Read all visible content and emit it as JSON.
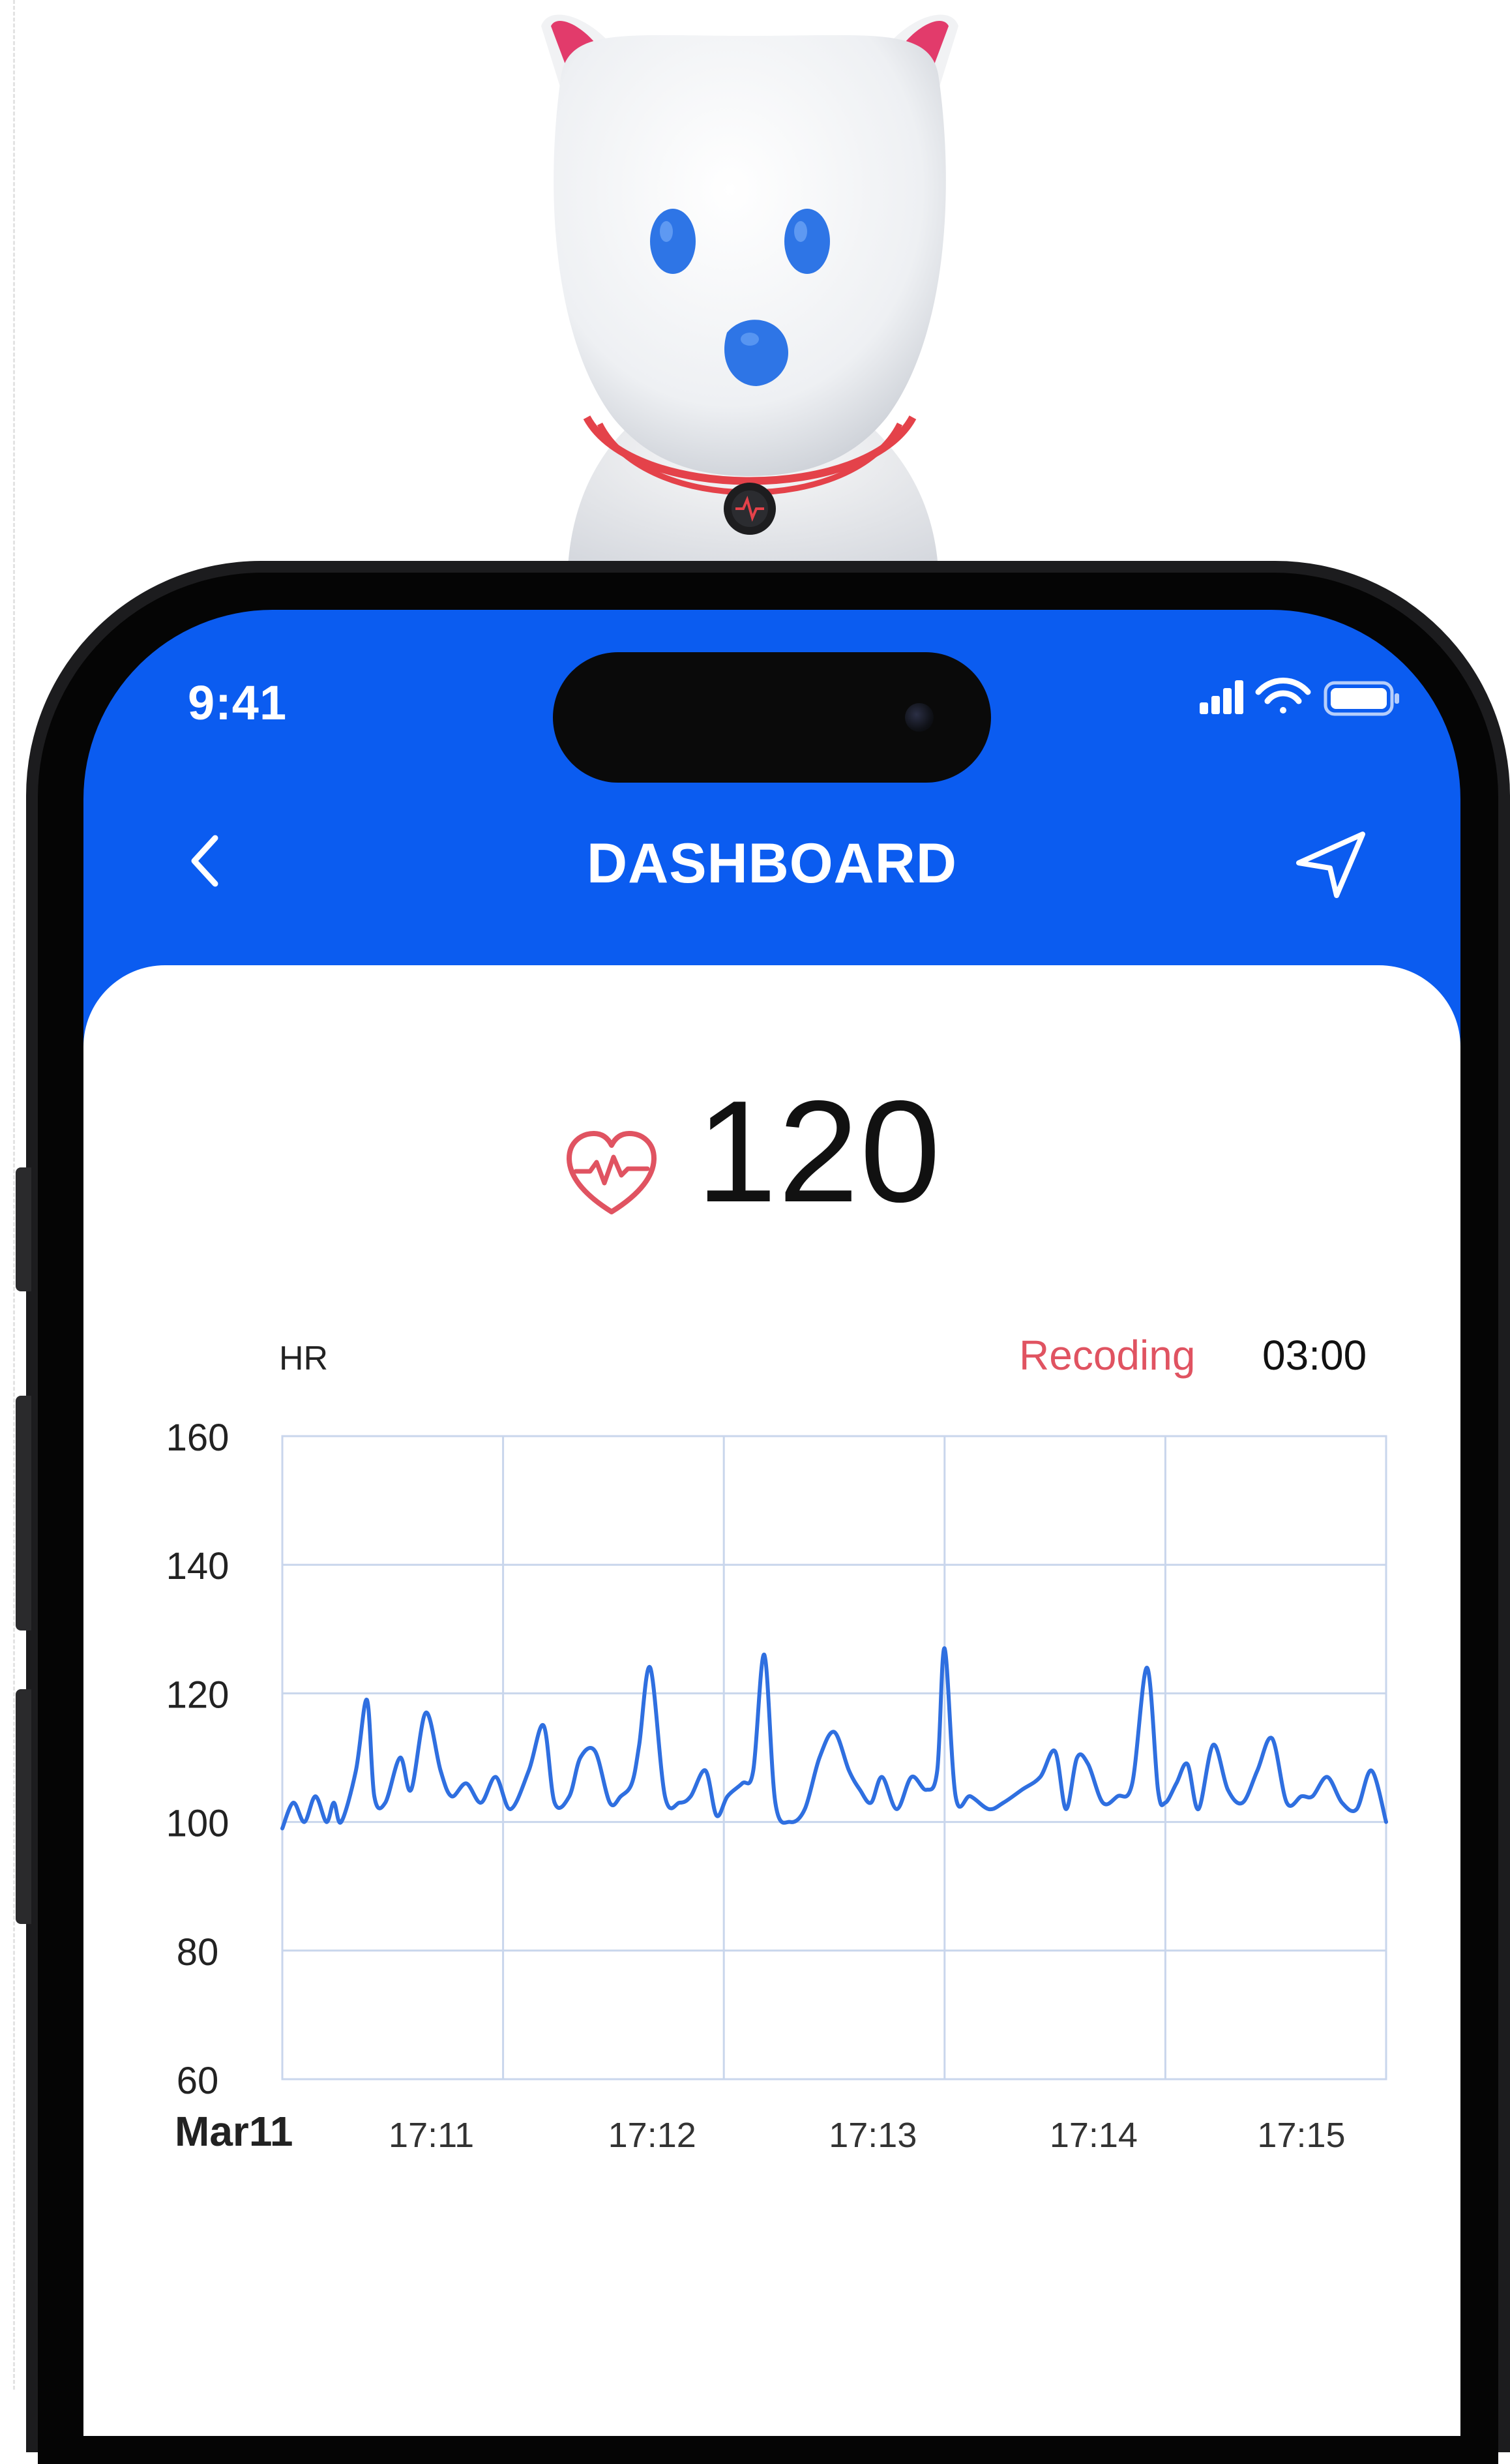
{
  "status_bar": {
    "time": "9:41"
  },
  "header": {
    "title": "DASHBOARD"
  },
  "heart_rate": {
    "value": "120"
  },
  "recording": {
    "label": "Recoding",
    "timer": "03:00"
  },
  "colors": {
    "brand_blue": "#0b5cf0",
    "alert_red": "#e05361",
    "line_blue": "#2f6fe0",
    "grid": "#c9d6ec"
  },
  "icons": [
    "back-chevron-icon",
    "send-icon",
    "heart-pulse-icon",
    "cellular-signal-icon",
    "wifi-icon",
    "battery-icon",
    "play-icon"
  ],
  "chart_data": {
    "type": "line",
    "ylabel": "HR",
    "ylim": [
      60,
      160
    ],
    "yticks": [
      "160",
      "140",
      "120",
      "100",
      "80",
      "60"
    ],
    "date_label": "Mar11",
    "xticks": [
      "17:11",
      "17:12",
      "17:13",
      "17:14",
      "17:15"
    ],
    "xlim": [
      "17:10",
      "17:15"
    ],
    "grid": true,
    "series": [
      {
        "color": "#2f6fe0",
        "x": [
          "17:10:00",
          "17:10:03",
          "17:10:06",
          "17:10:09",
          "17:10:12",
          "17:10:14",
          "17:10:16",
          "17:10:20",
          "17:10:23",
          "17:10:25",
          "17:10:28",
          "17:10:32",
          "17:10:35",
          "17:10:39",
          "17:10:43",
          "17:10:46",
          "17:10:50",
          "17:10:54",
          "17:10:58",
          "17:11:02",
          "17:11:07",
          "17:11:11",
          "17:11:14",
          "17:11:18",
          "17:11:21",
          "17:11:25",
          "17:11:29",
          "17:11:32",
          "17:11:35",
          "17:11:37",
          "17:11:40",
          "17:11:44",
          "17:11:48",
          "17:11:51",
          "17:11:55",
          "17:11:58",
          "17:12:01",
          "17:12:05",
          "17:12:08",
          "17:12:11",
          "17:12:14",
          "17:12:18",
          "17:12:22",
          "17:12:26",
          "17:12:30",
          "17:12:34",
          "17:12:37",
          "17:12:40",
          "17:12:43",
          "17:12:47",
          "17:12:51",
          "17:12:55",
          "17:12:58",
          "17:13:00",
          "17:13:03",
          "17:13:07",
          "17:13:12",
          "17:13:16",
          "17:13:21",
          "17:13:26",
          "17:13:30",
          "17:13:33",
          "17:13:36",
          "17:13:39",
          "17:13:43",
          "17:13:47",
          "17:13:51",
          "17:13:55",
          "17:13:58",
          "17:14:00",
          "17:14:03",
          "17:14:06",
          "17:14:09",
          "17:14:13",
          "17:14:17",
          "17:14:21",
          "17:14:25",
          "17:14:29",
          "17:14:33",
          "17:14:37",
          "17:14:40",
          "17:14:44",
          "17:14:48",
          "17:14:52",
          "17:14:56",
          "17:15:00"
        ],
        "values": [
          99,
          103,
          100,
          104,
          100,
          103,
          100,
          108,
          119,
          104,
          103,
          110,
          105,
          117,
          108,
          104,
          106,
          103,
          107,
          102,
          108,
          115,
          103,
          104,
          110,
          111,
          103,
          104,
          106,
          112,
          124,
          104,
          103,
          104,
          108,
          101,
          104,
          106,
          108,
          126,
          103,
          100,
          102,
          110,
          114,
          108,
          105,
          103,
          107,
          102,
          107,
          105,
          108,
          127,
          104,
          104,
          102,
          103,
          105,
          107,
          111,
          102,
          110,
          109,
          103,
          104,
          106,
          124,
          105,
          103,
          106,
          109,
          102,
          112,
          105,
          103,
          108,
          113,
          103,
          104,
          104,
          107,
          103,
          102,
          108,
          100
        ]
      }
    ]
  }
}
